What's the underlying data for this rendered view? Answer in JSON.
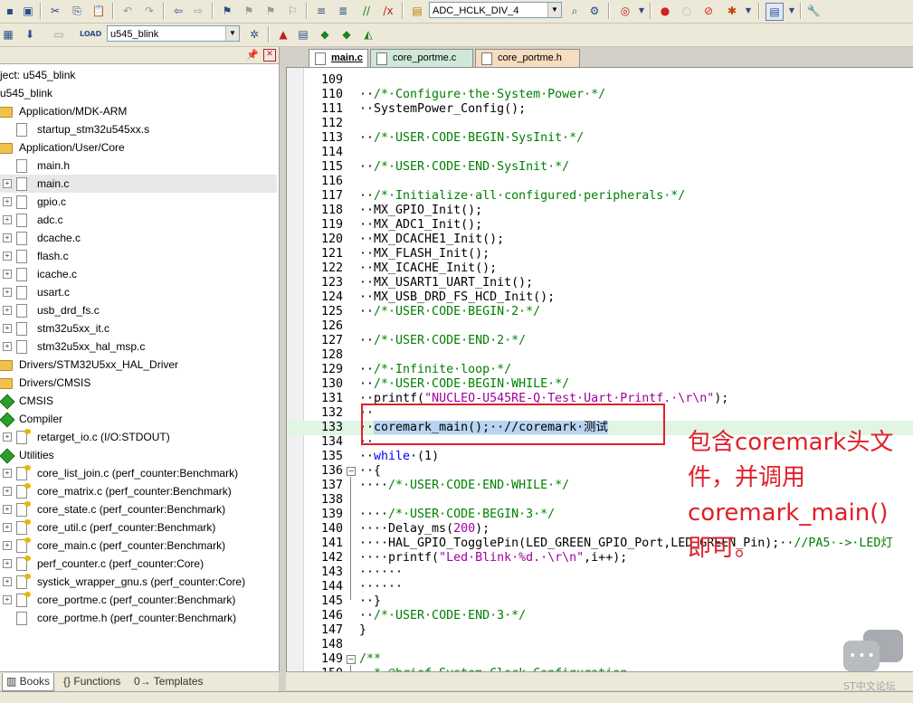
{
  "toolbar": {
    "target_combo_value": "ADC_HCLK_DIV_4",
    "project_combo_value": "u545_blink"
  },
  "project_pane": {
    "tree": [
      {
        "label": "ject: u545_blink",
        "kind": "none"
      },
      {
        "label": "u545_blink",
        "kind": "none"
      },
      {
        "label": "Application/MDK-ARM",
        "kind": "folder"
      },
      {
        "label": "startup_stm32u545xx.s",
        "kind": "file"
      },
      {
        "label": "Application/User/Core",
        "kind": "folder"
      },
      {
        "label": "main.h",
        "kind": "file"
      },
      {
        "label": "main.c",
        "kind": "file"
      },
      {
        "label": "gpio.c",
        "kind": "file"
      },
      {
        "label": "adc.c",
        "kind": "file"
      },
      {
        "label": "dcache.c",
        "kind": "file"
      },
      {
        "label": "flash.c",
        "kind": "file"
      },
      {
        "label": "icache.c",
        "kind": "file"
      },
      {
        "label": "usart.c",
        "kind": "file"
      },
      {
        "label": "usb_drd_fs.c",
        "kind": "file"
      },
      {
        "label": "stm32u5xx_it.c",
        "kind": "file"
      },
      {
        "label": "stm32u5xx_hal_msp.c",
        "kind": "file"
      },
      {
        "label": "Drivers/STM32U5xx_HAL_Driver",
        "kind": "folder"
      },
      {
        "label": "Drivers/CMSIS",
        "kind": "folder"
      },
      {
        "label": "CMSIS",
        "kind": "gem"
      },
      {
        "label": "Compiler",
        "kind": "gem"
      },
      {
        "label": "retarget_io.c (I/O:STDOUT)",
        "kind": "filekey"
      },
      {
        "label": "Utilities",
        "kind": "gem"
      },
      {
        "label": "core_list_join.c (perf_counter:Benchmark)",
        "kind": "filekey"
      },
      {
        "label": "core_matrix.c (perf_counter:Benchmark)",
        "kind": "filekey"
      },
      {
        "label": "core_state.c (perf_counter:Benchmark)",
        "kind": "filekey"
      },
      {
        "label": "core_util.c (perf_counter:Benchmark)",
        "kind": "filekey"
      },
      {
        "label": "core_main.c (perf_counter:Benchmark)",
        "kind": "filekey"
      },
      {
        "label": "perf_counter.c (perf_counter:Core)",
        "kind": "filekey"
      },
      {
        "label": "systick_wrapper_gnu.s (perf_counter:Core)",
        "kind": "filekey"
      },
      {
        "label": "core_portme.c (perf_counter:Benchmark)",
        "kind": "filekey"
      },
      {
        "label": "core_portme.h (perf_counter:Benchmark)",
        "kind": "file"
      }
    ],
    "tabs": [
      "Books",
      "Functions",
      "Templates"
    ]
  },
  "editor": {
    "tabs": [
      "main.c",
      "core_portme.c",
      "core_portme.h"
    ],
    "lines": [
      {
        "n": "109",
        "parts": [
          [
            "",
            ""
          ]
        ]
      },
      {
        "n": "110",
        "parts": [
          [
            "",
            "··"
          ],
          [
            "cm",
            "/*·Configure·the·System·Power·*/"
          ]
        ]
      },
      {
        "n": "111",
        "parts": [
          [
            "",
            "··SystemPower_Config();"
          ]
        ]
      },
      {
        "n": "112",
        "parts": [
          [
            "",
            ""
          ]
        ]
      },
      {
        "n": "113",
        "parts": [
          [
            "",
            "··"
          ],
          [
            "cm",
            "/*·USER·CODE·BEGIN·SysInit·*/"
          ]
        ]
      },
      {
        "n": "114",
        "parts": [
          [
            "",
            ""
          ]
        ]
      },
      {
        "n": "115",
        "parts": [
          [
            "",
            "··"
          ],
          [
            "cm",
            "/*·USER·CODE·END·SysInit·*/"
          ]
        ]
      },
      {
        "n": "116",
        "parts": [
          [
            "",
            ""
          ]
        ]
      },
      {
        "n": "117",
        "parts": [
          [
            "",
            "··"
          ],
          [
            "cm",
            "/*·Initialize·all·configured·peripherals·*/"
          ]
        ]
      },
      {
        "n": "118",
        "parts": [
          [
            "",
            "··MX_GPIO_Init();"
          ]
        ]
      },
      {
        "n": "119",
        "parts": [
          [
            "",
            "··MX_ADC1_Init();"
          ]
        ]
      },
      {
        "n": "120",
        "parts": [
          [
            "",
            "··MX_DCACHE1_Init();"
          ]
        ]
      },
      {
        "n": "121",
        "parts": [
          [
            "",
            "··MX_FLASH_Init();"
          ]
        ]
      },
      {
        "n": "122",
        "parts": [
          [
            "",
            "··MX_ICACHE_Init();"
          ]
        ]
      },
      {
        "n": "123",
        "parts": [
          [
            "",
            "··MX_USART1_UART_Init();"
          ]
        ]
      },
      {
        "n": "124",
        "parts": [
          [
            "",
            "··MX_USB_DRD_FS_HCD_Init();"
          ]
        ]
      },
      {
        "n": "125",
        "parts": [
          [
            "",
            "··"
          ],
          [
            "cm",
            "/*·USER·CODE·BEGIN·2·*/"
          ]
        ]
      },
      {
        "n": "126",
        "parts": [
          [
            "",
            ""
          ]
        ]
      },
      {
        "n": "127",
        "parts": [
          [
            "",
            "··"
          ],
          [
            "cm",
            "/*·USER·CODE·END·2·*/"
          ]
        ]
      },
      {
        "n": "128",
        "parts": [
          [
            "",
            ""
          ]
        ]
      },
      {
        "n": "129",
        "parts": [
          [
            "",
            "··"
          ],
          [
            "cm",
            "/*·Infinite·loop·*/"
          ]
        ]
      },
      {
        "n": "130",
        "parts": [
          [
            "",
            "··"
          ],
          [
            "cm",
            "/*·USER·CODE·BEGIN·WHILE·*/"
          ]
        ]
      },
      {
        "n": "131",
        "parts": [
          [
            "",
            "··printf("
          ],
          [
            "str",
            "\"NUCLEO-U545RE-Q·Test·Uart·Printf.·\\r\\n\""
          ],
          [
            "",
            ");"
          ]
        ]
      },
      {
        "n": "132",
        "parts": [
          [
            "",
            "··"
          ]
        ]
      },
      {
        "n": "133",
        "parts": [
          [
            "",
            "··"
          ],
          [
            "selc",
            "coremark_main();··//coremark·测试"
          ]
        ],
        "hl": true
      },
      {
        "n": "134",
        "parts": [
          [
            "",
            "··"
          ]
        ]
      },
      {
        "n": "135",
        "parts": [
          [
            "",
            "··"
          ],
          [
            "kw",
            "while"
          ],
          [
            "",
            "·(1)"
          ]
        ]
      },
      {
        "n": "136",
        "parts": [
          [
            "",
            "··{"
          ]
        ],
        "fold": "-"
      },
      {
        "n": "137",
        "parts": [
          [
            "",
            "····"
          ],
          [
            "cm",
            "/*·USER·CODE·END·WHILE·*/"
          ]
        ]
      },
      {
        "n": "138",
        "parts": [
          [
            "",
            ""
          ]
        ]
      },
      {
        "n": "139",
        "parts": [
          [
            "",
            "····"
          ],
          [
            "cm",
            "/*·USER·CODE·BEGIN·3·*/"
          ]
        ]
      },
      {
        "n": "140",
        "parts": [
          [
            "",
            "····Delay_ms("
          ],
          [
            "num",
            "200"
          ],
          [
            "",
            ");"
          ]
        ]
      },
      {
        "n": "141",
        "parts": [
          [
            "",
            "····HAL_GPIO_TogglePin(LED_GREEN_GPIO_Port,LED_GREEN_Pin);··"
          ],
          [
            "cm",
            "//PA5·->·LED灯"
          ]
        ]
      },
      {
        "n": "142",
        "parts": [
          [
            "",
            "····printf("
          ],
          [
            "str",
            "\"Led·Blink·%d.·\\r\\n\""
          ],
          [
            "",
            ",i++);"
          ]
        ]
      },
      {
        "n": "143",
        "parts": [
          [
            "",
            "······"
          ]
        ]
      },
      {
        "n": "144",
        "parts": [
          [
            "",
            "······"
          ]
        ]
      },
      {
        "n": "145",
        "parts": [
          [
            "",
            "··}"
          ]
        ]
      },
      {
        "n": "146",
        "parts": [
          [
            "",
            "··"
          ],
          [
            "cm",
            "/*·USER·CODE·END·3·*/"
          ]
        ]
      },
      {
        "n": "147",
        "parts": [
          [
            "",
            "}"
          ]
        ]
      },
      {
        "n": "148",
        "parts": [
          [
            "",
            ""
          ]
        ]
      },
      {
        "n": "149",
        "parts": [
          [
            "",
            ""
          ],
          [
            "cm",
            "/**"
          ]
        ],
        "fold": "-"
      },
      {
        "n": "150",
        "parts": [
          [
            "",
            "··"
          ],
          [
            "cm",
            "*·@brief·System·Clock·Configuration"
          ]
        ]
      }
    ]
  },
  "annotation": {
    "text": "包含coremark头文件，并调用coremark_main()即可。",
    "color": "#e0202a"
  },
  "watermark": {
    "text": "ST中文论坛"
  },
  "colors": {
    "comment": "#008000",
    "keyword": "#0000ff",
    "string": "#a000a0",
    "highlight_line": "#e1f5e4",
    "selection": "#b8d4f2"
  }
}
